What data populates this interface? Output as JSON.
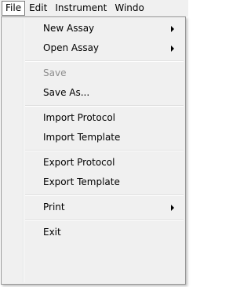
{
  "menubar": {
    "items": [
      {
        "label": "File"
      },
      {
        "label": "Edit"
      },
      {
        "label": "Instrument"
      },
      {
        "label": "Windo"
      }
    ]
  },
  "file_menu": {
    "new_assay": "New Assay",
    "open_assay": "Open Assay",
    "save": "Save",
    "save_as": "Save As...",
    "import_protocol": "Import Protocol",
    "import_template": "Import Template",
    "export_protocol": "Export Protocol",
    "export_template": "Export Template",
    "print": "Print",
    "exit": "Exit"
  }
}
